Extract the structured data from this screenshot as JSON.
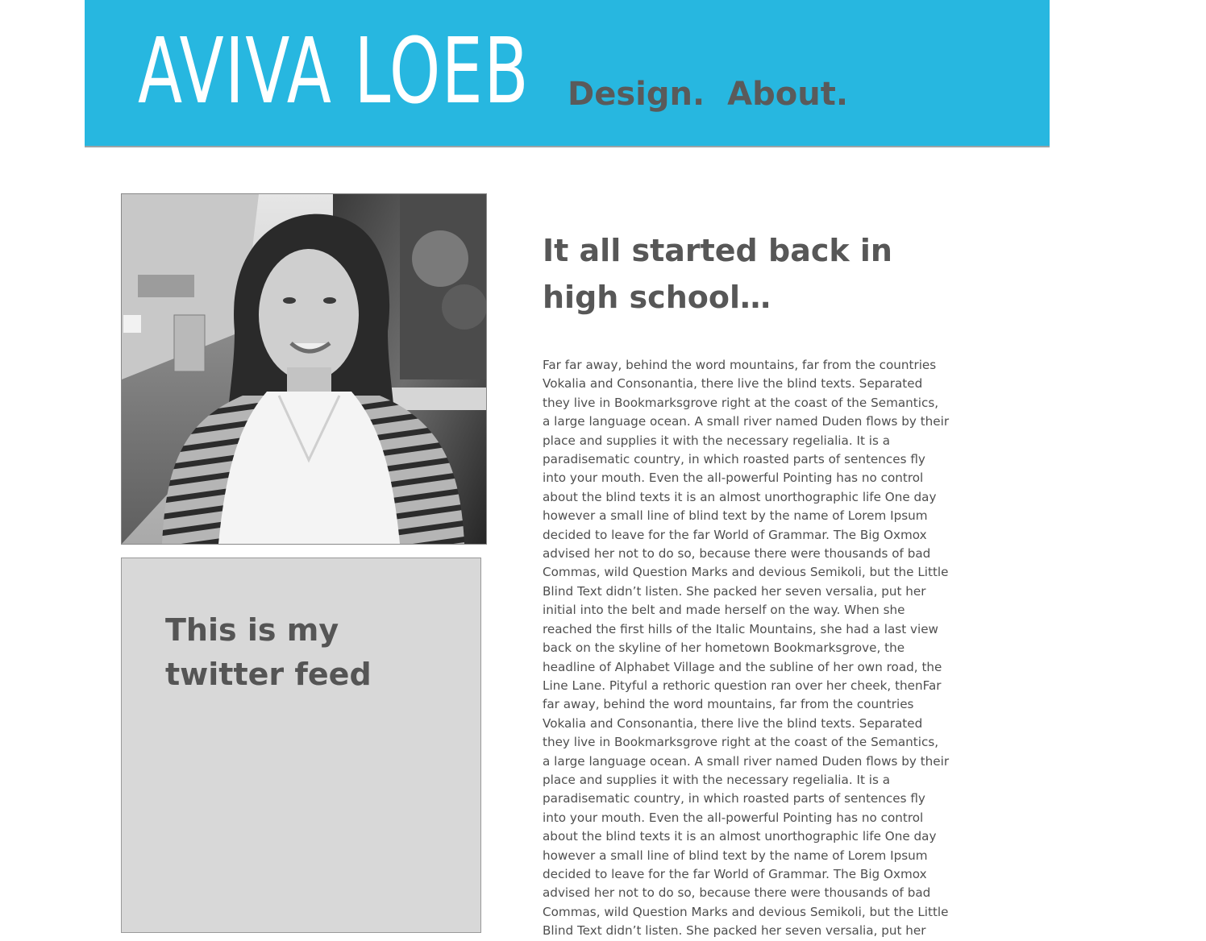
{
  "header": {
    "logo": "AVIVA LOEB",
    "nav": [
      {
        "label": "Design."
      },
      {
        "label": "About."
      }
    ]
  },
  "sidebar": {
    "twitter_title": "This is my twitter feed"
  },
  "article": {
    "title": "It all started back in high school…",
    "body": "Far far away, behind the word mountains, far from the countries Vokalia and Consonantia, there live the blind texts. Separated they live in Bookmarksgrove right at the coast of the Semantics, a large language ocean. A small river named Duden flows by their place and supplies it with the necessary regelialia. It is a paradisematic country, in which roasted parts of sentences fly into your mouth. Even the all-powerful Pointing has no control about the blind texts it is an almost unorthographic life One day however a small line of blind text by the name of Lorem Ipsum decided to leave for the far World of Grammar. The Big Oxmox advised her not to do so, because there were thousands of bad Commas, wild Question Marks and devious Semikoli, but the Little Blind Text didn’t listen. She packed her seven versalia, put her initial into the belt and made herself on the way. When she reached the first hills of the Italic Mountains, she had a last view back on the skyline of her hometown Bookmarksgrove, the headline of Alphabet Village and the subline of her own road, the Line Lane. Pityful a rethoric question ran over her cheek, thenFar far away, behind the word mountains, far from the countries Vokalia and Consonantia, there live the blind texts. Separated they live in Bookmarksgrove right at the coast of the Semantics, a large language ocean. A small river named Duden flows by their place and supplies it with the necessary regelialia. It is a paradisematic country, in which roasted parts of sentences fly into your mouth. Even the all-powerful Pointing has no control about the blind texts it is an almost unorthographic life One day however a small line of blind text by the name of Lorem Ipsum decided to leave for the far World of Grammar. The Big Oxmox advised her not to do so, because there were thousands of bad Commas, wild Question Marks and devious Semikoli, but the Little Blind Text didn’t listen. She packed her seven versalia, put her initial into the belt and made herself on the way."
  },
  "colors": {
    "header_bg": "#27b7e0",
    "logo_text": "#ffffff",
    "nav_text": "#5a5a5a",
    "twitter_bg": "#d8d8d8",
    "body_text": "#4f4f4f"
  }
}
